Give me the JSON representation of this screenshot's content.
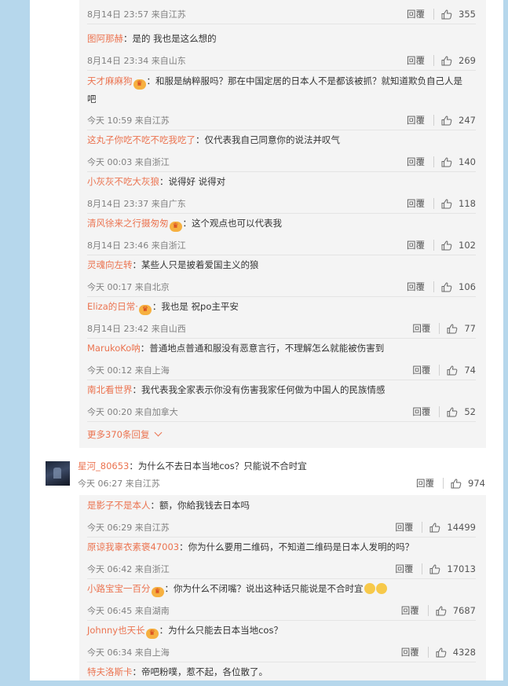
{
  "colors": {
    "accent": "#eb7350",
    "page_bg": "#b6d7ec",
    "reply_bg": "#f4f4f4"
  },
  "actions": {
    "reply_label": "回覆",
    "like_icon": "thumbs-up-icon"
  },
  "replies_block1": [
    {
      "user": "",
      "text": "",
      "meta": "8月14日 23:57 来自江苏",
      "likes": "355"
    },
    {
      "user": "图阿那赫",
      "badge": false,
      "text": "：是的 我也是这么想的",
      "meta": "8月14日 23:34 来自山东",
      "likes": "269"
    },
    {
      "user": "天才麻麻狗",
      "badge": true,
      "text": "：和服是納粹服吗？那在中国定居的日本人不是都该被抓？就知道欺负自己人是吧",
      "meta": "今天 10:59 来自江苏",
      "likes": "247"
    },
    {
      "user": "这丸子你吃不吃不吃我吃了",
      "badge": false,
      "text": "：仅代表我自己同意你的说法并叹气",
      "meta": "今天 00:03 来自浙江",
      "likes": "140"
    },
    {
      "user": "小灰灰不吃大灰狼",
      "badge": false,
      "text": "：说得好 说得对",
      "meta": "8月14日 23:37 来自广东",
      "likes": "118"
    },
    {
      "user": "清风徐来之行摄匆匆",
      "badge": true,
      "text": "：这个观点也可以代表我",
      "meta": "8月14日 23:46 来自浙江",
      "likes": "102"
    },
    {
      "user": "灵魂向左转",
      "badge": false,
      "text": "：某些人只是披着爱国主义的狼",
      "meta": "今天 00:17 来自北京",
      "likes": "106"
    },
    {
      "user": "Eliza的日常·",
      "badge": true,
      "text": "：我也是 祝po主平安",
      "meta": "8月14日 23:42 来自山西",
      "likes": "77"
    },
    {
      "user": "MarukoKo呐",
      "badge": false,
      "text": "：普通地点普通和服没有恶意言行，不理解怎么就能被伤害到",
      "meta": "今天 00:12 来自上海",
      "likes": "74"
    },
    {
      "user": "南北看世界",
      "badge": false,
      "text": "：我代表我全家表示你没有伤害我家任何做为中国人的民族情感",
      "meta": "今天 00:20 来自加拿大",
      "likes": "52"
    }
  ],
  "more_replies": "更多370条回复",
  "main_comment": {
    "user": "星河_80653",
    "text": "：为什么不去日本当地cos？只能说不合时宜",
    "meta": "今天 06:27 来自江苏",
    "likes": "974"
  },
  "replies_block2": [
    {
      "user": "是影子不是本人",
      "badge": false,
      "text": "：额，你給我钱去日本吗",
      "meta": "今天 06:29 来自江苏",
      "likes": "14499"
    },
    {
      "user": "原谅我辜衣素褒47003",
      "badge": false,
      "text": "：你为什么要用二维码，不知道二维码是日本人发明的吗？",
      "meta": "今天 06:42 来自浙江",
      "likes": "17013"
    },
    {
      "user": "小路宝宝一百分",
      "badge": true,
      "text": "：你为什么不闭嘴？说出这种话只能说是不合时宜",
      "emoji": true,
      "meta": "今天 06:45 来自湖南",
      "likes": "7687"
    },
    {
      "user": "Johnny也天长",
      "badge": true,
      "text": "：为什么只能去日本当地cos？",
      "meta": "今天 06:34 来自上海",
      "likes": "4328"
    },
    {
      "user": "特夫洛斯卡",
      "badge": false,
      "text": "：帝吧粉噗，惹不起，各位散了。",
      "meta": "",
      "likes": ""
    }
  ]
}
